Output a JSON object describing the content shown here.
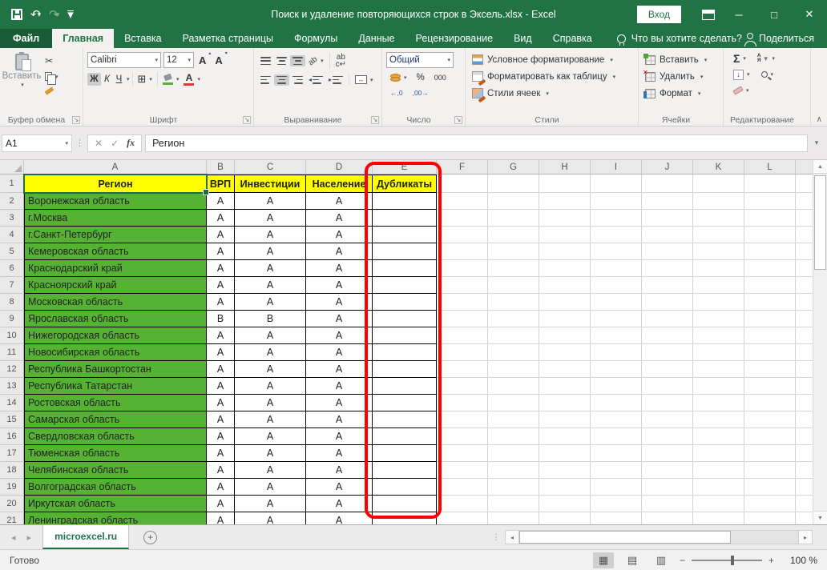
{
  "titlebar": {
    "title": "Поиск и удаление повторяющихся строк в Эксель.xlsx  -  Excel",
    "sign_in": "Вход"
  },
  "tabs": {
    "file": "Файл",
    "items": [
      "Главная",
      "Вставка",
      "Разметка страницы",
      "Формулы",
      "Данные",
      "Рецензирование",
      "Вид",
      "Справка"
    ],
    "active": "Главная",
    "tell_me": "Что вы хотите сделать?",
    "share": "Поделиться"
  },
  "ribbon": {
    "clipboard": {
      "label": "Буфер обмена",
      "paste": "Вставить"
    },
    "font": {
      "label": "Шрифт",
      "family": "Calibri",
      "size": "12",
      "bold": "Ж",
      "italic": "К",
      "underline": "Ч",
      "grow": "А",
      "shrink": "А",
      "color_letter": "А"
    },
    "alignment": {
      "label": "Выравнивание",
      "orient": "ab",
      "wrap_top": "ab",
      "wrap_arrow": "c↵",
      "merge_arrow": "↔"
    },
    "number": {
      "label": "Число",
      "format": "Общий",
      "percent": "%",
      "thousands": "000",
      "inc_decimal": "←,0",
      "dec_decimal": ",00→"
    },
    "styles": {
      "label": "Стили",
      "conditional": "Условное форматирование",
      "format_table": "Форматировать как таблицу",
      "cell_styles": "Стили ячеек"
    },
    "cells": {
      "label": "Ячейки",
      "insert": "Вставить",
      "delete": "Удалить",
      "format": "Формат"
    },
    "editing": {
      "label": "Редактирование",
      "sum": "Σ",
      "sort_a": "А",
      "sort_b": "Я",
      "fill": "↓"
    }
  },
  "formula_bar": {
    "name_box": "A1",
    "fx": "fx",
    "content": "Регион"
  },
  "sheet": {
    "columns": [
      "A",
      "B",
      "C",
      "D",
      "E",
      "F",
      "G",
      "H",
      "I",
      "J",
      "K",
      "L"
    ],
    "header_row": {
      "num": "1",
      "cells": [
        "Регион",
        "ВРП",
        "Инвестиции",
        "Население",
        "Дубликаты"
      ]
    },
    "rows": [
      {
        "num": "2",
        "region": "Воронежская область",
        "vrp": "А",
        "inv": "А",
        "pop": "А",
        "dup": ""
      },
      {
        "num": "3",
        "region": "г.Москва",
        "vrp": "А",
        "inv": "А",
        "pop": "А",
        "dup": ""
      },
      {
        "num": "4",
        "region": "г.Санкт-Петербург",
        "vrp": "А",
        "inv": "А",
        "pop": "А",
        "dup": ""
      },
      {
        "num": "5",
        "region": "Кемеровская область",
        "vrp": "А",
        "inv": "А",
        "pop": "А",
        "dup": ""
      },
      {
        "num": "6",
        "region": "Краснодарский край",
        "vrp": "А",
        "inv": "А",
        "pop": "А",
        "dup": ""
      },
      {
        "num": "7",
        "region": "Красноярский край",
        "vrp": "А",
        "inv": "А",
        "pop": "А",
        "dup": ""
      },
      {
        "num": "8",
        "region": "Московская область",
        "vrp": "А",
        "inv": "А",
        "pop": "А",
        "dup": ""
      },
      {
        "num": "9",
        "region": "Ярославская область",
        "vrp": "В",
        "inv": "В",
        "pop": "А",
        "dup": ""
      },
      {
        "num": "10",
        "region": "Нижегородская область",
        "vrp": "А",
        "inv": "А",
        "pop": "А",
        "dup": ""
      },
      {
        "num": "11",
        "region": "Новосибирская область",
        "vrp": "А",
        "inv": "А",
        "pop": "А",
        "dup": ""
      },
      {
        "num": "12",
        "region": "Республика Башкортостан",
        "vrp": "А",
        "inv": "А",
        "pop": "А",
        "dup": ""
      },
      {
        "num": "13",
        "region": "Республика Татарстан",
        "vrp": "А",
        "inv": "А",
        "pop": "А",
        "dup": ""
      },
      {
        "num": "14",
        "region": "Ростовская область",
        "vrp": "А",
        "inv": "А",
        "pop": "А",
        "dup": ""
      },
      {
        "num": "15",
        "region": "Самарская область",
        "vrp": "А",
        "inv": "А",
        "pop": "А",
        "dup": ""
      },
      {
        "num": "16",
        "region": "Свердловская область",
        "vrp": "А",
        "inv": "А",
        "pop": "А",
        "dup": ""
      },
      {
        "num": "17",
        "region": "Тюменская область",
        "vrp": "А",
        "inv": "А",
        "pop": "А",
        "dup": ""
      },
      {
        "num": "18",
        "region": "Челябинская область",
        "vrp": "А",
        "inv": "А",
        "pop": "А",
        "dup": ""
      },
      {
        "num": "19",
        "region": "Волгоградская область",
        "vrp": "А",
        "inv": "А",
        "pop": "А",
        "dup": ""
      },
      {
        "num": "20",
        "region": "Иркутская область",
        "vrp": "А",
        "inv": "А",
        "pop": "А",
        "dup": ""
      },
      {
        "num": "21",
        "region": "Ленинградская область",
        "vrp": "А",
        "inv": "А",
        "pop": "А",
        "dup": ""
      }
    ]
  },
  "sheet_tabs": {
    "active": "microexcel.ru"
  },
  "status_bar": {
    "mode": "Готово",
    "zoom": "100 %"
  },
  "glyphs": {
    "undo": "↶",
    "redo": "↷",
    "dropdown": "▾",
    "up_small": "▴",
    "launcher": "↘",
    "cut": "✂",
    "borders": "⊞",
    "collapse": "∧",
    "minimize": "─",
    "maximize": "□",
    "close": "✕",
    "cancel": "✕",
    "enter": "✓",
    "vdots": "⋮",
    "nav_left": "◂",
    "nav_right": "▸",
    "add": "+",
    "view_normal": "▦",
    "view_layout": "▤",
    "view_break": "▥",
    "zoom_out": "−",
    "zoom_in": "+",
    "scroll_up": "▲",
    "scroll_down": "▼",
    "funnel": "▼"
  },
  "colors": {
    "excel_green": "#217346",
    "cell_green": "#55b232",
    "header_yellow": "#ffff00",
    "annotation_red": "#fd0000",
    "fill_color_bar": "#55b232",
    "font_color_bar": "#e03c31"
  }
}
